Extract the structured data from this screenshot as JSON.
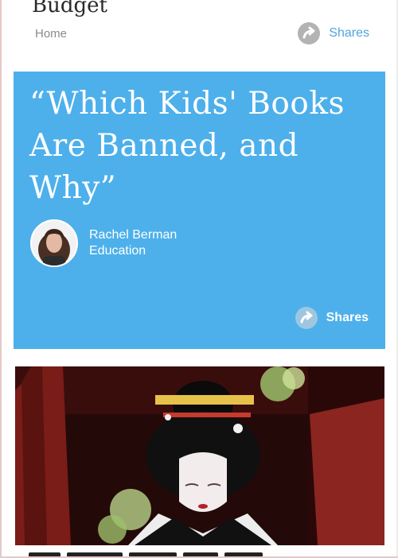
{
  "top_card": {
    "title": "Budget",
    "category": "Home",
    "share_label": "Shares",
    "share_icon": "share-arrow-icon"
  },
  "feature_card": {
    "title": "“Which Kids' Books Are Banned, and Why”",
    "author_name": "Rachel Berman",
    "author_section": "Education",
    "share_label": "Shares",
    "share_icon": "share-arrow-icon",
    "background_color": "#4db0eb"
  },
  "photo_card": {
    "image": "geisha-photo"
  }
}
